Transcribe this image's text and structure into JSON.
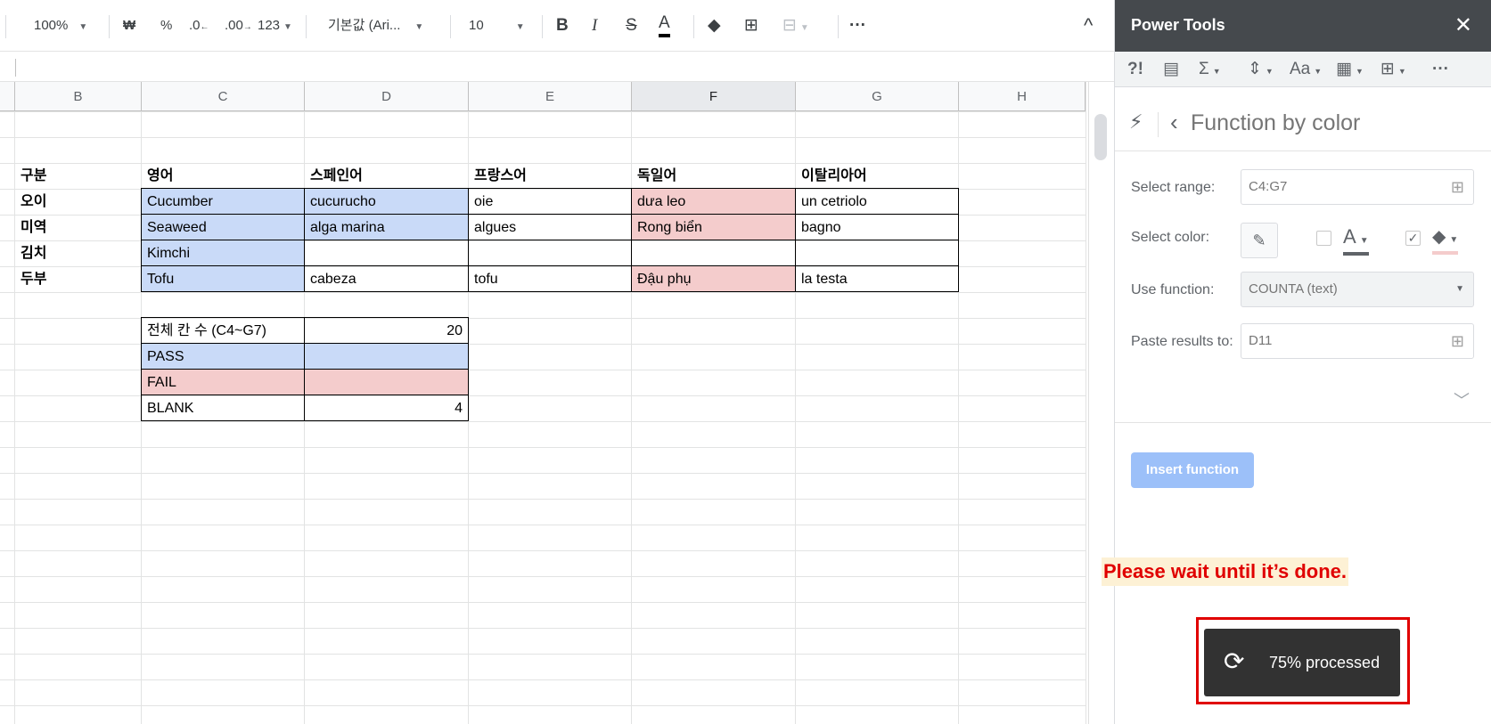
{
  "toolbar": {
    "zoom": "100%",
    "currency": "₩",
    "percent": "%",
    "dec_decrease": ".0",
    "dec_increase": ".00",
    "more_formats": "123",
    "font": "기본값 (Ari...",
    "font_size": "10",
    "bold": "B",
    "italic": "I",
    "strike": "S",
    "text_color": "A",
    "more": "···",
    "collapse": "^"
  },
  "sheet": {
    "columns": [
      "B",
      "C",
      "D",
      "E",
      "F",
      "G",
      "H"
    ],
    "selected_column": "F",
    "headers": [
      "구분",
      "영어",
      "스페인어",
      "프랑스어",
      "독일어",
      "이탈리아어"
    ],
    "rows": [
      [
        "오이",
        "Cucumber",
        "cucurucho",
        "oie",
        "dưa leo",
        "un cetriolo"
      ],
      [
        "미역",
        "Seaweed",
        "alga marina",
        "algues",
        "Rong biển",
        "bagno"
      ],
      [
        "김치",
        "Kimchi",
        "",
        "",
        "",
        ""
      ],
      [
        "두부",
        "Tofu",
        "cabeza",
        "tofu",
        "Đậu phụ",
        "la testa"
      ]
    ],
    "summary": [
      {
        "label": "전체 칸 수 (C4~G7)",
        "value": "20"
      },
      {
        "label": "PASS",
        "value": ""
      },
      {
        "label": "FAIL",
        "value": ""
      },
      {
        "label": "BLANK",
        "value": "4"
      }
    ]
  },
  "sidebar": {
    "title": "Power Tools",
    "close": "✕",
    "section_title": "Function by color",
    "select_range_label": "Select range:",
    "select_range_value": "C4:G7",
    "select_color_label": "Select color:",
    "use_function_label": "Use function:",
    "use_function_value": "COUNTA (text)",
    "paste_results_label": "Paste results to:",
    "paste_results_value": "D11",
    "insert_button": "Insert function"
  },
  "overlay": {
    "wait_message": "Please wait until it’s done.",
    "progress_text": "75% processed"
  },
  "colors": {
    "blue_fill": "#c9daf8",
    "pink_fill": "#f4cccc",
    "sidebar_header": "#45494d",
    "insert_button": "#9cc0f9",
    "warning_text": "#e00000"
  }
}
